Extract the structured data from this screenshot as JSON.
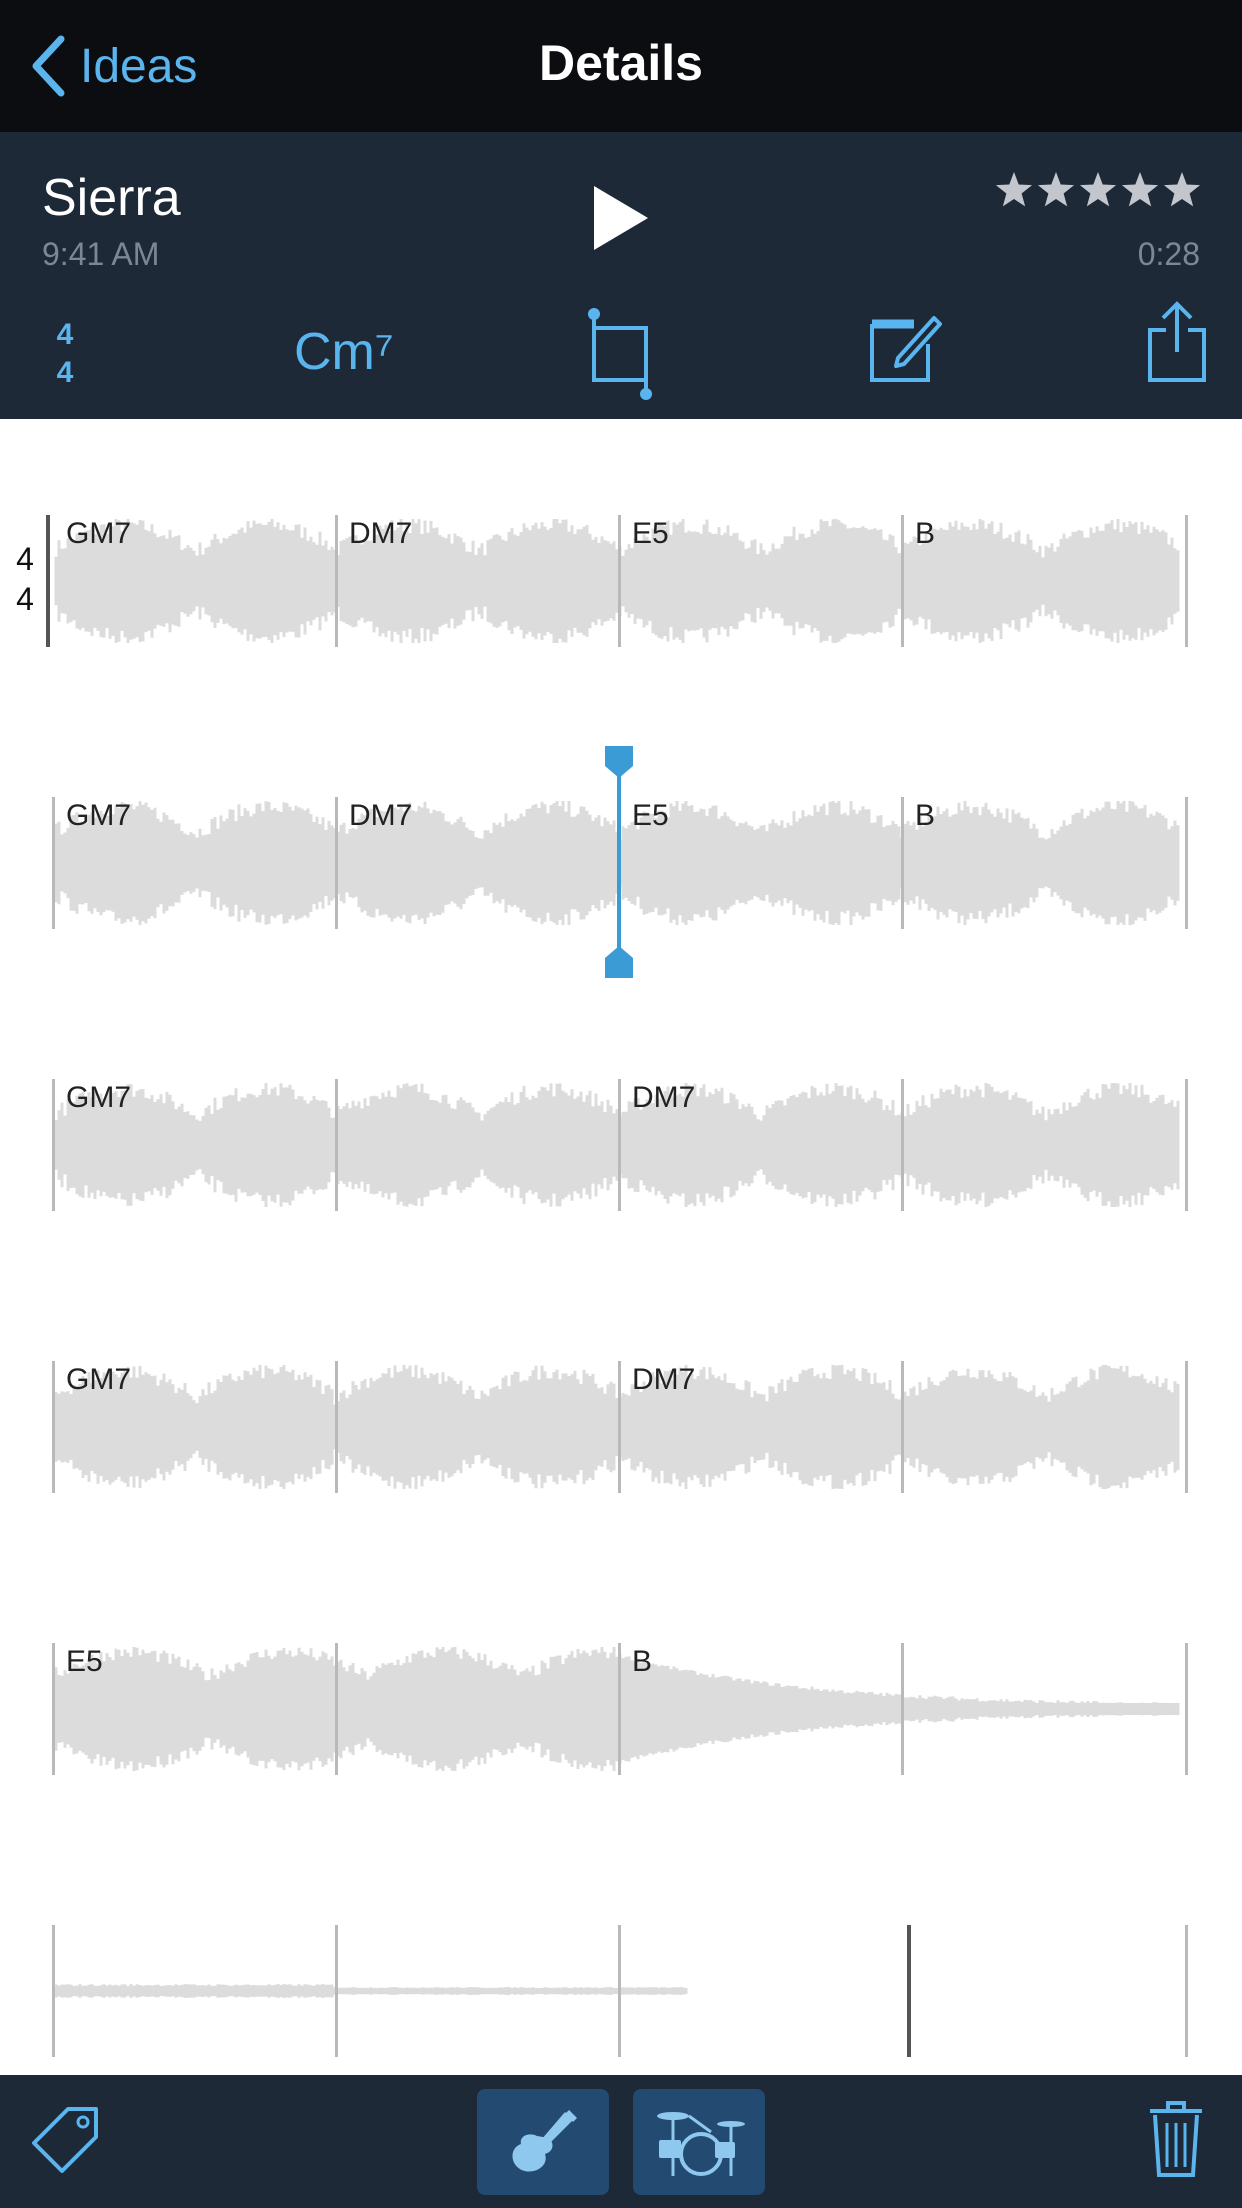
{
  "nav": {
    "back_label": "Ideas",
    "title": "Details"
  },
  "song": {
    "title": "Sierra",
    "time": "9:41 AM",
    "duration": "0:28",
    "rating": 5,
    "rating_max": 5
  },
  "controls": {
    "time_signature": {
      "top": "4",
      "bottom": "4"
    },
    "key": "Cm⁷"
  },
  "score": {
    "time_signature": {
      "top": "4",
      "bottom": "4"
    },
    "rows": [
      {
        "chords": [
          "GM7",
          "DM7",
          "E5",
          "B"
        ]
      },
      {
        "chords": [
          "GM7",
          "DM7",
          "E5",
          "B"
        ]
      },
      {
        "chords": [
          "GM7",
          "",
          "DM7",
          ""
        ]
      },
      {
        "chords": [
          "GM7",
          "",
          "DM7",
          ""
        ]
      },
      {
        "chords": [
          "E5",
          "",
          "B",
          ""
        ]
      },
      {
        "chords": [
          "",
          "",
          "",
          ""
        ]
      }
    ]
  },
  "playhead": {
    "row": 2,
    "bar": 3
  },
  "colors": {
    "accent": "#5ab4ee",
    "playhead": "#3a9bd5",
    "navbar_bg": "#0c0d10",
    "panel_bg": "#1e2938",
    "active_tool_bg": "#234a70",
    "waveform": "#dcdcdc"
  },
  "icons": {
    "back": "chevron-left-icon",
    "play": "play-icon",
    "star": "star-icon",
    "crop": "crop-icon",
    "edit": "edit-icon",
    "share": "share-icon",
    "tag": "tag-icon",
    "guitar": "guitar-icon",
    "drums": "drums-icon",
    "trash": "trash-icon"
  }
}
